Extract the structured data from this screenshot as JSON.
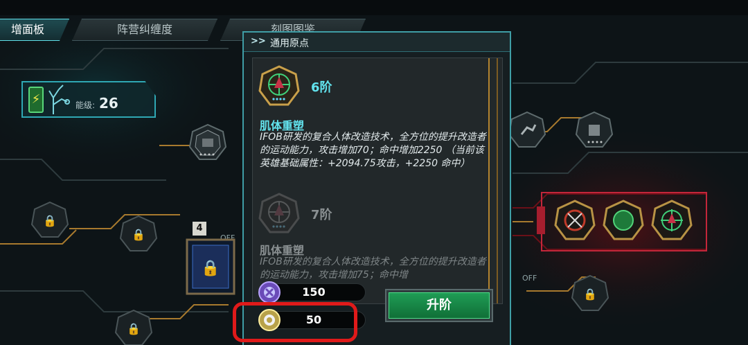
{
  "tabs": [
    {
      "label": "增面板",
      "active": true
    },
    {
      "label": "阵营纠缠度",
      "active": false
    },
    {
      "label": "刻图图鉴",
      "active": false
    }
  ],
  "level": {
    "label": "能级:",
    "value": "26"
  },
  "popup": {
    "arrows": ">>",
    "title": "通用原点",
    "entries": [
      {
        "rank": "6阶",
        "name": "肌体重塑",
        "description": "IFOB研发的复合人体改造技术，全方位的提升改造者的运动能力，攻击增加70；命中增加2250 （当前该英雄基础属性：+2094.75攻击，+2250 命中）"
      },
      {
        "rank": "7阶",
        "name": "肌体重塑",
        "description": "IFOB研发的复合人体改造技术，全方位的提升改造者的运动能力，攻击增加75；命中增"
      }
    ],
    "resources": [
      {
        "icon": "purple-core-icon",
        "amount": "150"
      },
      {
        "icon": "gold-core-icon",
        "amount": "50"
      }
    ],
    "upgrade_label": "升阶"
  },
  "board": {
    "off_label": "OFF",
    "node_number": "4"
  },
  "colors": {
    "accent": "#3f9ea6",
    "highlight": "#e01a1a",
    "upgrade": "#1f9c55",
    "active_rank": "#62e3ee",
    "inactive_rank": "#8a9092"
  }
}
